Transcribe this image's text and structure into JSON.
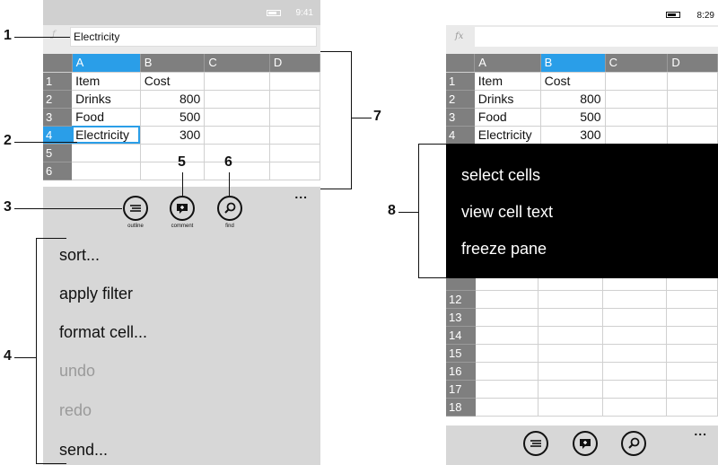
{
  "left_phone": {
    "status_time": "9:41",
    "formula_value": "Electricity",
    "columns": [
      "A",
      "B",
      "C",
      "D"
    ],
    "rows": [
      {
        "num": "1",
        "a": "Item",
        "b": "Cost"
      },
      {
        "num": "2",
        "a": "Drinks",
        "b": "800"
      },
      {
        "num": "3",
        "a": "Food",
        "b": "500"
      },
      {
        "num": "4",
        "a": "Electricity",
        "b": "300"
      },
      {
        "num": "5",
        "a": "",
        "b": ""
      },
      {
        "num": "6",
        "a": "",
        "b": ""
      }
    ],
    "app_buttons": [
      {
        "label": "outline",
        "icon": "outline-icon"
      },
      {
        "label": "comment",
        "icon": "comment-icon"
      },
      {
        "label": "find",
        "icon": "search-icon"
      }
    ],
    "more": "...",
    "menu_items": [
      {
        "label": "sort...",
        "enabled": true
      },
      {
        "label": "apply filter",
        "enabled": true
      },
      {
        "label": "format cell...",
        "enabled": true
      },
      {
        "label": "undo",
        "enabled": false
      },
      {
        "label": "redo",
        "enabled": false
      },
      {
        "label": "send...",
        "enabled": true
      }
    ]
  },
  "right_phone": {
    "status_time": "8:29",
    "fx_label": "fx",
    "formula_value": "",
    "columns": [
      "A",
      "B",
      "C",
      "D"
    ],
    "rows": [
      {
        "num": "1",
        "a": "Item",
        "b": "Cost"
      },
      {
        "num": "2",
        "a": "Drinks",
        "b": "800"
      },
      {
        "num": "3",
        "a": "Food",
        "b": "500"
      },
      {
        "num": "4",
        "a": "Electricity",
        "b": "300"
      }
    ],
    "lower_rows": [
      "12",
      "13",
      "14",
      "15",
      "16",
      "17",
      "18"
    ],
    "context_menu": [
      "select cells",
      "view cell text",
      "freeze pane"
    ],
    "more": "..."
  },
  "callouts": [
    "1",
    "2",
    "3",
    "4",
    "5",
    "6",
    "7",
    "8"
  ],
  "colors": {
    "accent": "#2a9ee8",
    "header_gray": "#7f7f7f",
    "appbar_gray": "#d7d7d7",
    "context_menu_bg": "#000000"
  }
}
